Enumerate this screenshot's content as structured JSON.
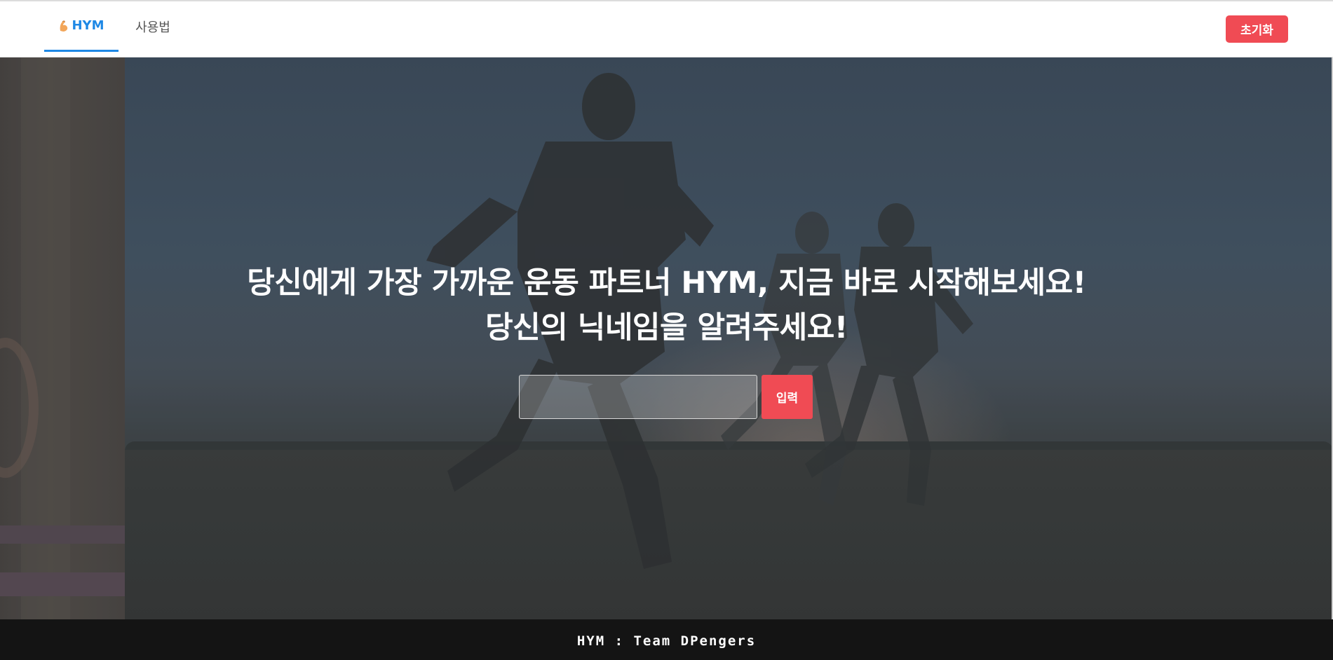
{
  "header": {
    "tabs": [
      {
        "label": "HYM",
        "icon": "flexed-biceps-icon",
        "active": true
      },
      {
        "label": "사용법",
        "active": false
      }
    ],
    "reset_label": "초기화"
  },
  "hero": {
    "headline_line1": "당신에게 가장 가까운 운동 파트너 HYM, 지금 바로 시작해보세요!",
    "headline_line2": "당신의 닉네임을 알려주세요!",
    "nickname_value": "",
    "submit_label": "입력"
  },
  "footer": {
    "text": "HYM : Team DPengers"
  },
  "colors": {
    "accent_blue": "#1e88e5",
    "button_red": "#f04b54",
    "footer_bg": "#141414"
  }
}
